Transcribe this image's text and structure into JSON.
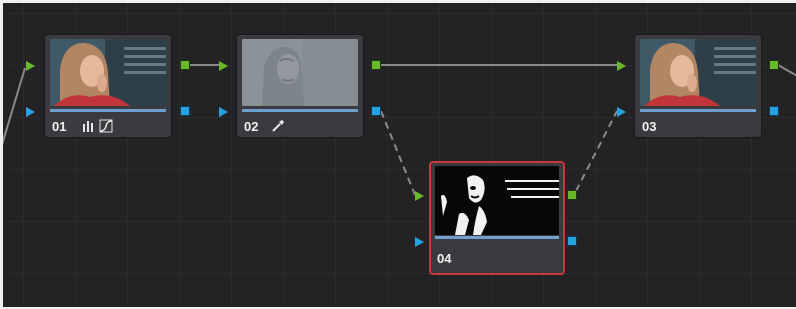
{
  "nodes": [
    {
      "label": "01",
      "tools": [
        "bars-icon",
        "curve-icon"
      ]
    },
    {
      "label": "02",
      "tools": [
        "qualifier-picker-icon"
      ]
    },
    {
      "label": "03",
      "tools": []
    },
    {
      "label": "04",
      "tools": []
    }
  ],
  "colors": {
    "rgb_port": "#69b82b",
    "alpha_port": "#27a2e0",
    "selected_outline": "#c9383a",
    "wire": "#8a8a8a"
  }
}
